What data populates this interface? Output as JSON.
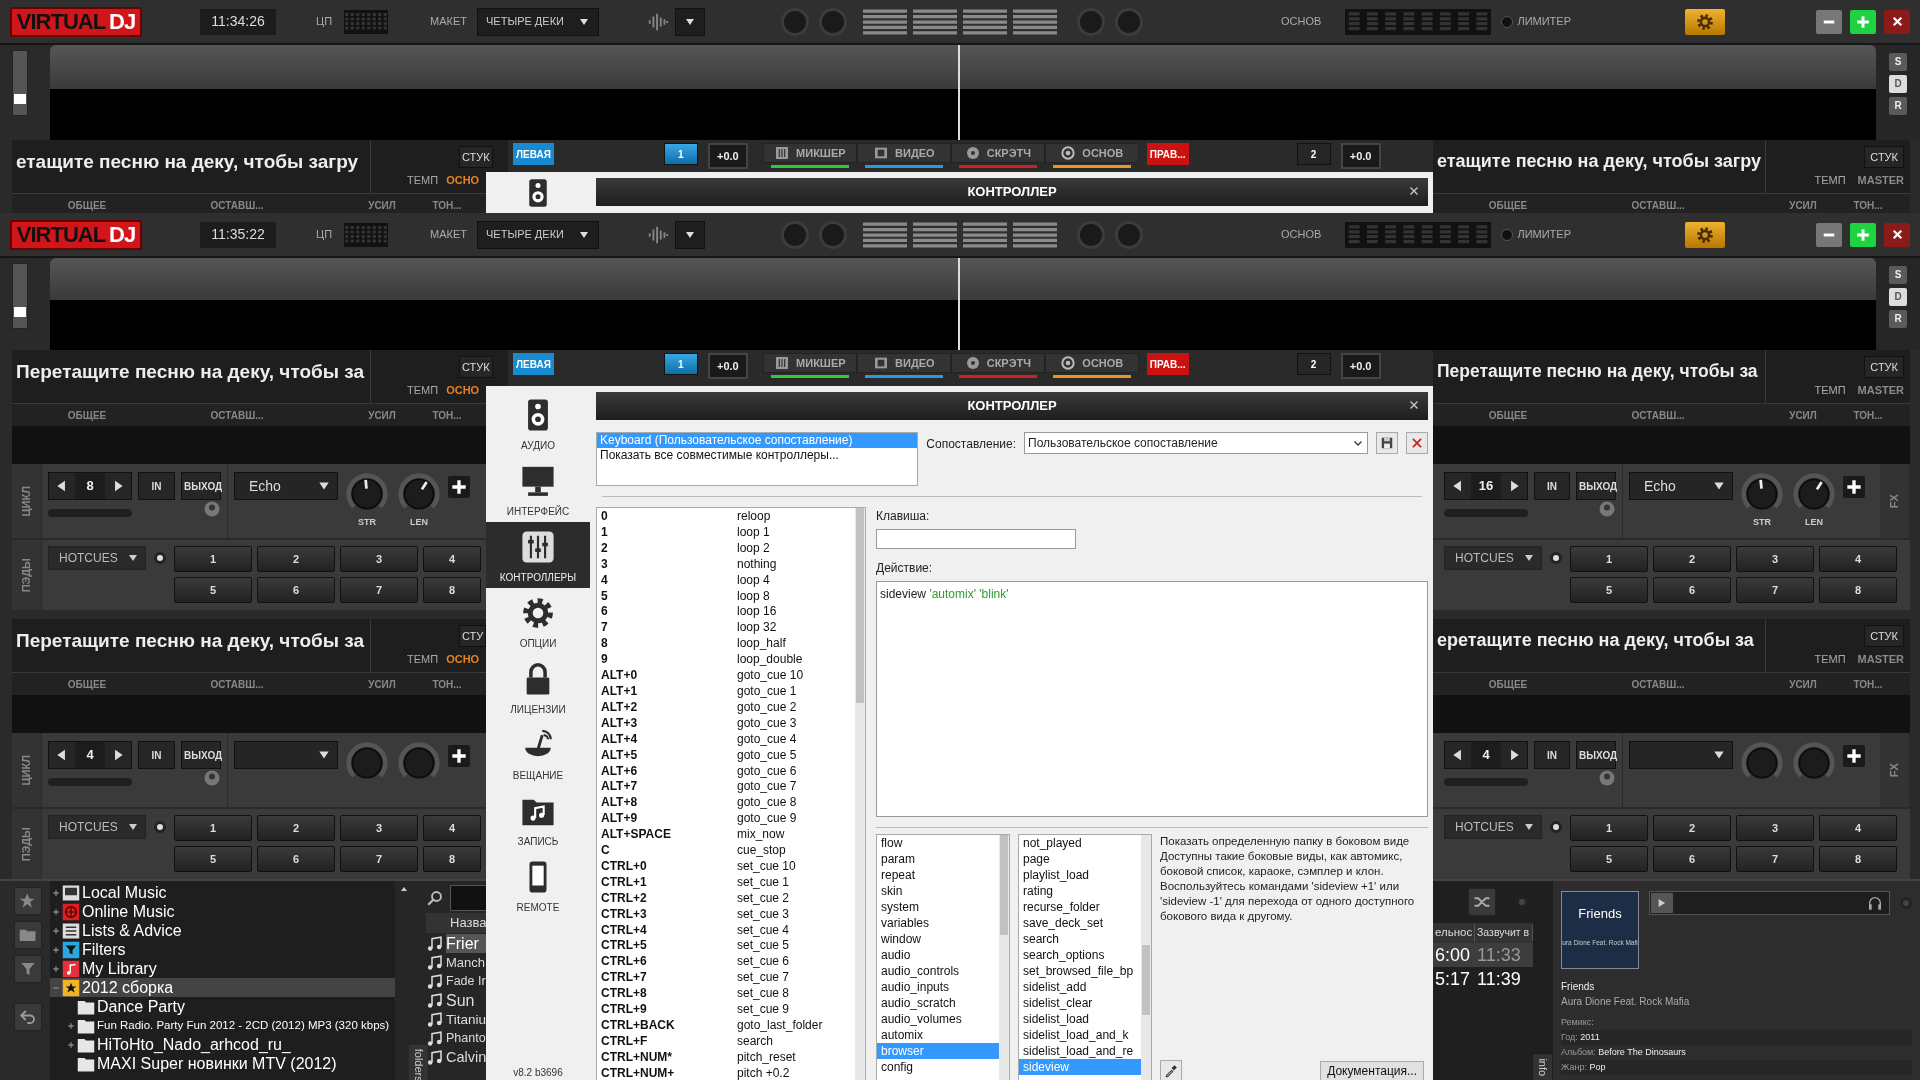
{
  "back_screen": {
    "top_bar": {
      "logo": [
        "VIRTUAL",
        "DJ"
      ],
      "time": "11:34:26",
      "cpu_label": "ЦП",
      "layout_label": "МАКЕТ",
      "layout_value": "ЧЕТЫРЕ ДЕКИ",
      "master_label": "ОСНОВ",
      "limiter_label": "ЛИМИТЕР"
    },
    "waveform": {
      "level": 0.2,
      "side_buttons": [
        {
          "label": "S",
          "selected": false
        },
        {
          "label": "D",
          "selected": true
        },
        {
          "label": "R",
          "selected": false
        }
      ]
    },
    "deck_headers": [
      {
        "title": "етащите песню на деку, чтобы загру",
        "sync": "СТУК",
        "tempo_label": "ТЕМП",
        "key_label": "ОСНО",
        "key_active": true,
        "columns": [
          "ОБЩЕЕ",
          "ОСТАВШ...",
          "УСИЛ",
          "ТОН..."
        ]
      },
      {
        "title": "етащите песню на деку, чтобы загру",
        "sync": "СТУК",
        "tempo_label": "ТЕМП",
        "key_label": "MASTER",
        "key_active": false,
        "columns": [
          "ОБЩЕЕ",
          "ОСТАВШ...",
          "УСИЛ",
          "ТОН..."
        ]
      }
    ],
    "center_strip": {
      "sides": [
        {
          "label": "ЛЕВАЯ",
          "color": "#1a8ad0",
          "deck": "1",
          "deck_selected": true,
          "pitch": "+0.0"
        },
        {
          "label": "ПРАВ...",
          "color": "#cc1111",
          "deck": "2",
          "deck_selected": false,
          "pitch": "+0.0"
        }
      ],
      "tabs": [
        {
          "label": "МИКШЕР",
          "kind": "mixer",
          "color": "#35c83a"
        },
        {
          "label": "ВИДЕО",
          "kind": "film",
          "color": "#2b9bd8"
        },
        {
          "label": "СКРЭТЧ",
          "kind": "disc",
          "color": "#d02020"
        },
        {
          "label": "ОСНОВ",
          "kind": "target",
          "color": "#e8961e"
        }
      ]
    },
    "dialog": {
      "title": "КОНТРОЛЛЕР",
      "sidebar": [
        {
          "kind": "speaker"
        }
      ]
    }
  },
  "front_screen": {
    "top_bar": {
      "logo": [
        "VIRTUAL",
        "DJ"
      ],
      "time": "11:35:22",
      "cpu_label": "ЦП",
      "layout_label": "МАКЕТ",
      "layout_value": "ЧЕТЫРЕ ДЕКИ",
      "master_label": "ОСНОВ",
      "limiter_label": "ЛИМИТЕР"
    },
    "waveform": {
      "level": 0.2,
      "side_buttons": [
        {
          "label": "S",
          "selected": false
        },
        {
          "label": "D",
          "selected": true
        },
        {
          "label": "R",
          "selected": false
        }
      ]
    },
    "center_strip": {
      "sides": [
        {
          "label": "ЛЕВАЯ",
          "color": "#1a8ad0",
          "deck": "1",
          "deck_selected": true,
          "pitch": "+0.0"
        },
        {
          "label": "ПРАВ...",
          "color": "#cc1111",
          "deck": "2",
          "deck_selected": false,
          "pitch": "+0.0"
        }
      ],
      "tabs": [
        {
          "label": "МИКШЕР",
          "kind": "mixer",
          "color": "#35c83a"
        },
        {
          "label": "ВИДЕО",
          "kind": "film",
          "color": "#2b9bd8"
        },
        {
          "label": "СКРЭТЧ",
          "kind": "disc",
          "color": "#d02020"
        },
        {
          "label": "ОСНОВ",
          "kind": "target",
          "color": "#e8961e"
        }
      ]
    },
    "decks": [
      {
        "kind": "left",
        "header": {
          "title": "Перетащите песню на деку, чтобы за",
          "sync": "СТУК",
          "tempo_label": "ТЕМП",
          "key_label": "ОСНО",
          "key_active": true,
          "columns": [
            "ОБЩЕЕ",
            "ОСТАВШ...",
            "УСИЛ",
            "ТОН..."
          ]
        },
        "loop": {
          "label": "ЦИКЛ",
          "size": "8",
          "level": 0,
          "in": "IN",
          "out": "ВЫХОД"
        },
        "fx": {
          "name": "Echo",
          "knobs": [
            {
              "kind": "dial",
              "label": "STR",
              "level": 0.48
            },
            {
              "kind": "dial",
              "label": "LEN",
              "level": 0.62
            }
          ]
        },
        "pads": {
          "label": "ПЭДЫ",
          "mode": "HOTCUES",
          "buttons": [
            "1",
            "2",
            "3",
            "4",
            "5",
            "6",
            "7",
            "8"
          ]
        }
      },
      {
        "kind": "right",
        "header": {
          "title": "Перетащите песню на деку, чтобы за",
          "sync": "СТУК",
          "tempo_label": "ТЕМП",
          "key_label": "MASTER",
          "key_active": false,
          "columns": [
            "ОБЩЕЕ",
            "ОСТАВШ...",
            "УСИЛ",
            "ТОН..."
          ]
        },
        "loop": {
          "size": "16",
          "level": 0,
          "in": "IN",
          "out": "ВЫХОД"
        },
        "fx": {
          "name": "Echo",
          "label": "FX",
          "knobs": [
            {
              "kind": "dial",
              "label": "STR",
              "level": 0.48
            },
            {
              "kind": "dial",
              "label": "LEN",
              "level": 0.62
            }
          ]
        },
        "pads": {
          "mode": "HOTCUES",
          "buttons": [
            "1",
            "2",
            "3",
            "4",
            "5",
            "6",
            "7",
            "8"
          ]
        }
      },
      {
        "kind": "left",
        "header": {
          "title": "Перетащите песню на деку, чтобы за",
          "sync": "СТУ",
          "tempo_label": "ТЕМП",
          "key_label": "ОСНО",
          "key_active": true,
          "columns": [
            "ОБЩЕЕ",
            "ОСТАВШ...",
            "УСИЛ",
            "ТОН..."
          ]
        },
        "loop": {
          "label": "ЦИКЛ",
          "size": "4",
          "level": 0,
          "in": "IN",
          "out": "ВЫХОД"
        },
        "fx": {
          "knobs": [
            {
              "kind": "blank"
            },
            {
              "kind": "blank"
            }
          ]
        },
        "pads": {
          "label": "ПЭДЫ",
          "mode": "HOTCUES",
          "buttons": [
            "1",
            "2",
            "3",
            "4",
            "5",
            "6",
            "7",
            "8"
          ]
        }
      },
      {
        "kind": "right",
        "header": {
          "title": "еретащите песню на деку, чтобы за",
          "sync": "СТУК",
          "tempo_label": "ТЕМП",
          "key_label": "MASTER",
          "key_active": false,
          "columns": [
            "ОБЩЕЕ",
            "ОСТАВШ...",
            "УСИЛ",
            "ТОН..."
          ]
        },
        "loop": {
          "size": "4",
          "level": 0,
          "in": "IN",
          "out": "ВЫХОД"
        },
        "fx": {
          "label": "FX",
          "knobs": [
            {
              "kind": "blank"
            },
            {
              "kind": "blank"
            }
          ]
        },
        "pads": {
          "mode": "HOTCUES",
          "buttons": [
            "1",
            "2",
            "3",
            "4",
            "5",
            "6",
            "7",
            "8"
          ]
        }
      }
    ],
    "browser": {
      "tools": [
        {
          "kind": "star"
        },
        {
          "kind": "folder"
        },
        {
          "kind": "filter"
        },
        {
          "kind": "back"
        }
      ],
      "tree": [
        {
          "label": "Local Music",
          "kind": "computer",
          "expanded": false,
          "selected": false
        },
        {
          "label": "Online Music",
          "kind": "globe",
          "expanded": false,
          "selected": false
        },
        {
          "label": "Lists & Advice",
          "kind": "list",
          "expanded": false,
          "selected": false
        },
        {
          "label": "Filters",
          "kind": "filter",
          "expanded": false,
          "selected": false
        },
        {
          "label": "My Library",
          "kind": "library",
          "expanded": false,
          "selected": false
        },
        {
          "label": "2012 сборка",
          "kind": "star",
          "expanded": true,
          "selected": true,
          "children": [
            {
              "label": "Dance Party",
              "kind": "folder",
              "selected": false
            },
            {
              "label": "Fun Radio. Party Fun 2012 - 2CD (2012) MP3 (320 kbps)",
              "kind": "folder",
              "expanded": false,
              "selected": false
            },
            {
              "label": "HiToHto_Nado_arhcod_ru_",
              "kind": "folder",
              "expanded": false,
              "selected": false
            },
            {
              "label": "MAXI Super новинки MTV (2012)",
              "kind": "folder",
              "selected": false
            }
          ]
        }
      ],
      "folders_tab": "folders",
      "song_header": "Назва",
      "songs": [
        {
          "title": "Frier",
          "selected": true
        },
        {
          "title": "Manch",
          "selected": false
        },
        {
          "title": "Fade Ir",
          "selected": false
        },
        {
          "title": "Sun",
          "selected": false
        },
        {
          "title": "Titaniu",
          "selected": false
        },
        {
          "title": "Phanto",
          "selected": false
        },
        {
          "title": "Calvin",
          "selected": false
        }
      ],
      "playlist": {
        "columns": [
          "ельнос",
          "Зазвучит в"
        ],
        "rows": [
          {
            "cells": [
              "6:00",
              "11:33"
            ],
            "selected": true
          },
          {
            "cells": [
              "5:17",
              "11:39"
            ],
            "selected": false
          }
        ]
      },
      "info_tab": "info",
      "info": {
        "cover_title": "Friends",
        "cover_subtitle": "ura Dione Feat. Rock Mafi",
        "title": "Friends",
        "artist": "Aura Dione Feat. Rock Mafia",
        "fields": [
          {
            "label": "Ремикс:"
          },
          {
            "label": "Год:",
            "value": "2011"
          },
          {
            "label": "Альбом:",
            "value": "Before The Dinosaurs"
          },
          {
            "label": "Жанр:",
            "value": "Pop"
          }
        ]
      }
    },
    "dialog": {
      "title": "КОНТРОЛЛЕР",
      "sidebar": [
        {
          "label": "АУДИО",
          "kind": "speaker",
          "selected": false
        },
        {
          "label": "ИНТЕРФЕЙС",
          "kind": "monitor",
          "selected": false
        },
        {
          "label": "КОНТРОЛЛЕРЫ",
          "kind": "sliders",
          "selected": true
        },
        {
          "label": "ОПЦИИ",
          "kind": "gear",
          "selected": false
        },
        {
          "label": "ЛИЦЕНЗИИ",
          "kind": "lock",
          "selected": false
        },
        {
          "label": "ВЕЩАНИЕ",
          "kind": "dish",
          "selected": false
        },
        {
          "label": "ЗАПИСЬ",
          "kind": "musicfolder",
          "selected": false
        },
        {
          "label": "REMOTE",
          "kind": "phone",
          "selected": false
        }
      ],
      "version": "v8.2 b3696",
      "controllers": [
        {
          "label": "Keyboard (Пользовательское сопоставление)",
          "selected": true
        },
        {
          "label": "Показать все совместимые контроллеры...",
          "selected": false
        }
      ],
      "mapping_label": "Сопоставление:",
      "mapping_value": "Пользовательское сопоставление",
      "mappings": [
        {
          "key": "0",
          "action": "reloop"
        },
        {
          "key": "1",
          "action": "loop 1"
        },
        {
          "key": "2",
          "action": "loop 2"
        },
        {
          "key": "3",
          "action": "nothing"
        },
        {
          "key": "4",
          "action": "loop 4"
        },
        {
          "key": "5",
          "action": "loop 8"
        },
        {
          "key": "6",
          "action": "loop 16"
        },
        {
          "key": "7",
          "action": "loop 32"
        },
        {
          "key": "8",
          "action": "loop_half"
        },
        {
          "key": "9",
          "action": "loop_double"
        },
        {
          "key": "ALT+0",
          "action": "goto_cue 10"
        },
        {
          "key": "ALT+1",
          "action": "goto_cue 1"
        },
        {
          "key": "ALT+2",
          "action": "goto_cue 2"
        },
        {
          "key": "ALT+3",
          "action": "goto_cue 3"
        },
        {
          "key": "ALT+4",
          "action": "goto_cue 4"
        },
        {
          "key": "ALT+5",
          "action": "goto_cue 5"
        },
        {
          "key": "ALT+6",
          "action": "goto_cue 6"
        },
        {
          "key": "ALT+7",
          "action": "goto_cue 7"
        },
        {
          "key": "ALT+8",
          "action": "goto_cue 8"
        },
        {
          "key": "ALT+9",
          "action": "goto_cue 9"
        },
        {
          "key": "ALT+SPACE",
          "action": "mix_now"
        },
        {
          "key": "C",
          "action": "cue_stop"
        },
        {
          "key": "CTRL+0",
          "action": "set_cue 10"
        },
        {
          "key": "CTRL+1",
          "action": "set_cue 1"
        },
        {
          "key": "CTRL+2",
          "action": "set_cue 2"
        },
        {
          "key": "CTRL+3",
          "action": "set_cue 3"
        },
        {
          "key": "CTRL+4",
          "action": "set_cue 4"
        },
        {
          "key": "CTRL+5",
          "action": "set_cue 5"
        },
        {
          "key": "CTRL+6",
          "action": "set_cue 6"
        },
        {
          "key": "CTRL+7",
          "action": "set_cue 7"
        },
        {
          "key": "CTRL+8",
          "action": "set_cue 8"
        },
        {
          "key": "CTRL+9",
          "action": "set_cue 9"
        },
        {
          "key": "CTRL+BACK",
          "action": "goto_last_folder"
        },
        {
          "key": "CTRL+F",
          "action": "search"
        },
        {
          "key": "CTRL+NUM*",
          "action": "pitch_reset"
        },
        {
          "key": "CTRL+NUM+",
          "action": "pitch +0.2"
        }
      ],
      "key_label": "Клавиша:",
      "action_label": "Действие:",
      "action": {
        "command": "sideview",
        "args": "'automix' 'blink'"
      },
      "categories": [
        {
          "label": "flow",
          "selected": false
        },
        {
          "label": "param",
          "selected": false
        },
        {
          "label": "repeat",
          "selected": false
        },
        {
          "label": "skin",
          "selected": false
        },
        {
          "label": "system",
          "selected": false
        },
        {
          "label": "variables",
          "selected": false
        },
        {
          "label": "window",
          "selected": false
        },
        {
          "label": "audio",
          "selected": false
        },
        {
          "label": "audio_controls",
          "selected": false
        },
        {
          "label": "audio_inputs",
          "selected": false
        },
        {
          "label": "audio_scratch",
          "selected": false
        },
        {
          "label": "audio_volumes",
          "selected": false
        },
        {
          "label": "automix",
          "selected": false
        },
        {
          "label": "browser",
          "selected": true
        },
        {
          "label": "config",
          "selected": false
        }
      ],
      "verbs": [
        {
          "label": "not_played",
          "selected": false
        },
        {
          "label": "page",
          "selected": false
        },
        {
          "label": "playlist_load",
          "selected": false
        },
        {
          "label": "rating",
          "selected": false
        },
        {
          "label": "recurse_folder",
          "selected": false
        },
        {
          "label": "save_deck_set",
          "selected": false
        },
        {
          "label": "search",
          "selected": false
        },
        {
          "label": "search_options",
          "selected": false
        },
        {
          "label": "set_browsed_file_bp",
          "selected": false
        },
        {
          "label": "sidelist_add",
          "selected": false
        },
        {
          "label": "sidelist_clear",
          "selected": false
        },
        {
          "label": "sidelist_load",
          "selected": false
        },
        {
          "label": "sidelist_load_and_k",
          "selected": false
        },
        {
          "label": "sidelist_load_and_re",
          "selected": false
        },
        {
          "label": "sideview",
          "selected": true
        }
      ],
      "description_title": "Показать определенную папку в боковом виде",
      "description": "Доступны такие боковые виды, как автомикс, боковой список, караоке, сэмплер и клон. Воспользуйтесь командами 'sideview +1' или 'sideview -1' для перехода от одного доступного бокового вида к другому.",
      "doc_button": "Документация..."
    }
  }
}
